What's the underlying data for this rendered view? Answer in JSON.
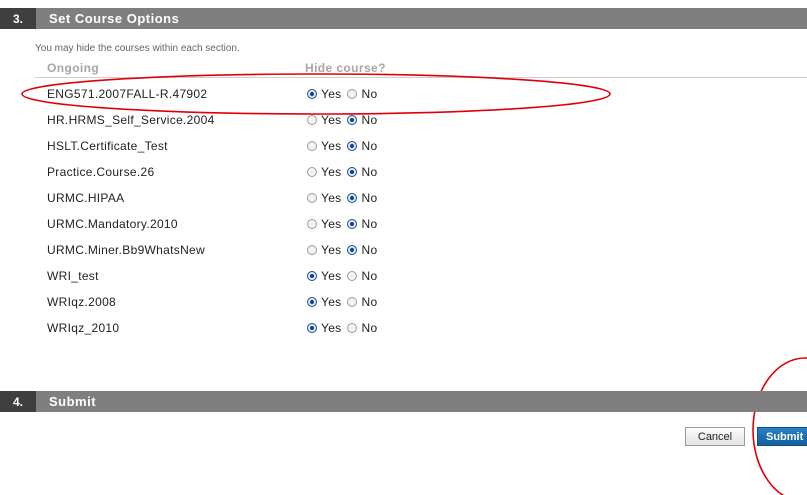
{
  "section3": {
    "number": "3.",
    "title": "Set Course Options",
    "instructions": "You may hide the courses within each section.",
    "col_ongoing": "Ongoing",
    "col_hide": "Hide course?",
    "yes_label": "Yes",
    "no_label": "No",
    "courses": [
      {
        "name": "ENG571.2007FALL-R.47902",
        "hide": "yes"
      },
      {
        "name": "HR.HRMS_Self_Service.2004",
        "hide": "no"
      },
      {
        "name": "HSLT.Certificate_Test",
        "hide": "no"
      },
      {
        "name": "Practice.Course.26",
        "hide": "no"
      },
      {
        "name": "URMC.HIPAA",
        "hide": "no"
      },
      {
        "name": "URMC.Mandatory.2010",
        "hide": "no"
      },
      {
        "name": "URMC.Miner.Bb9WhatsNew",
        "hide": "no"
      },
      {
        "name": "WRI_test",
        "hide": "yes"
      },
      {
        "name": "WRIqz.2008",
        "hide": "yes"
      },
      {
        "name": "WRIqz_2010",
        "hide": "yes"
      }
    ]
  },
  "section4": {
    "number": "4.",
    "title": "Submit"
  },
  "buttons": {
    "cancel": "Cancel",
    "submit": "Submit"
  },
  "colors": {
    "header_bar": "#7f7f7f",
    "header_number_bg": "#3f3f3f",
    "annotation": "#e0000a",
    "submit_bg": "#12609f"
  }
}
